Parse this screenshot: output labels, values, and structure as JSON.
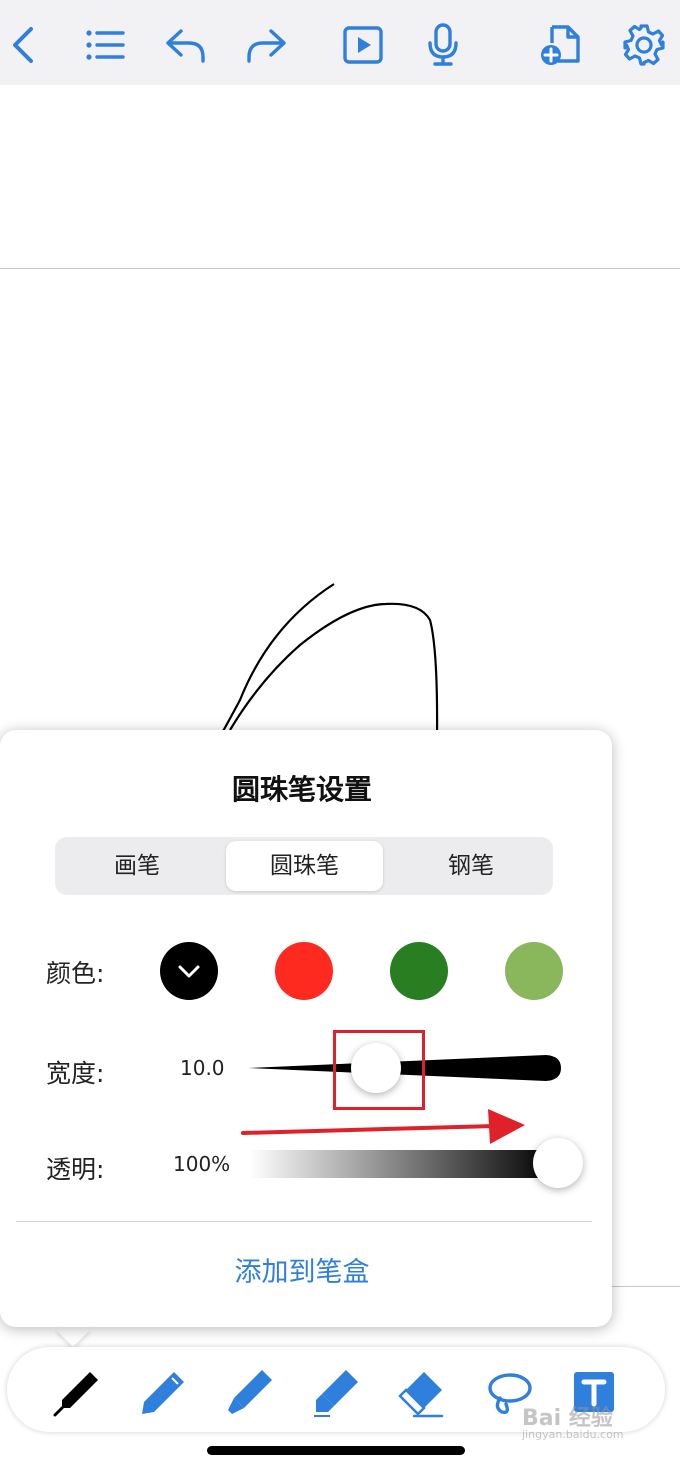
{
  "colors": {
    "accent": "#2f7fdc",
    "swatches": [
      "#000000",
      "#ff2a1f",
      "#2a7e22",
      "#8ab65c"
    ],
    "annotation": "#e0202a"
  },
  "topbar": {
    "icons": [
      "back-icon",
      "list-icon",
      "undo-icon",
      "redo-icon",
      "play-icon",
      "microphone-icon",
      "add-page-icon",
      "settings-icon"
    ]
  },
  "pen_settings": {
    "title": "圆珠笔设置",
    "tabs": [
      "画笔",
      "圆珠笔",
      "钢笔"
    ],
    "selected_tab": "圆珠笔",
    "color_label": "颜色:",
    "selected_color": "#000000",
    "width_label": "宽度:",
    "width_value": "10.0",
    "opacity_label": "透明:",
    "opacity_value": "100%",
    "opacity_fraction": 1.0,
    "add_button": "添加到笔盒"
  },
  "toolbar": {
    "tools": [
      "pen-icon",
      "pencil-icon",
      "marker-icon",
      "highlighter-icon",
      "eraser-icon",
      "lasso-icon",
      "text-icon"
    ],
    "selected_tool": "pen-icon"
  },
  "watermark": {
    "text": "Bai 经验",
    "sub": "jingyan.baidu.com"
  }
}
